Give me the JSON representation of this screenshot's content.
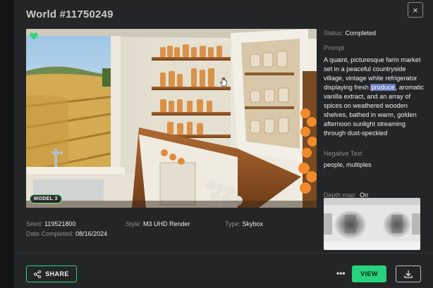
{
  "header": {
    "title": "World #11750249",
    "close_label": "×"
  },
  "preview": {
    "model_badge": "MODEL 3"
  },
  "side": {
    "status_label": "Status:",
    "status_value": "Completed",
    "prompt_label": "Prompt",
    "prompt_before": "A quaint, picturesque farm market set in a peaceful countryside village, vintage white refrigerator displaying fresh ",
    "prompt_highlight": "produce",
    "prompt_after": ", aromatic vanilla extract, and an array of spices on weathered wooden shelves, bathed in warm, golden afternoon sunlight streaming through dust-speckled",
    "negative_label": "Negative Text",
    "negative_value": "people, multiples",
    "depth_label": "Depth map:",
    "depth_value": "On"
  },
  "meta": {
    "seed_label": "Seed:",
    "seed_value": "119521800",
    "style_label": "Style:",
    "style_value": "M3 UHD Render",
    "type_label": "Type:",
    "type_value": "Skybox",
    "date_label": "Date Completed:",
    "date_value": "08/16/2024"
  },
  "footer": {
    "share_label": "SHARE",
    "more_label": "•••",
    "view_label": "VIEW"
  },
  "icons": {
    "favorite": "heart-icon",
    "share": "share-icon",
    "download": "download-icon",
    "close": "close-icon",
    "cursor": "hand-cursor-icon"
  },
  "colors": {
    "accent": "#27d27c",
    "highlight": "#6a7cbb",
    "background": "#242526"
  }
}
